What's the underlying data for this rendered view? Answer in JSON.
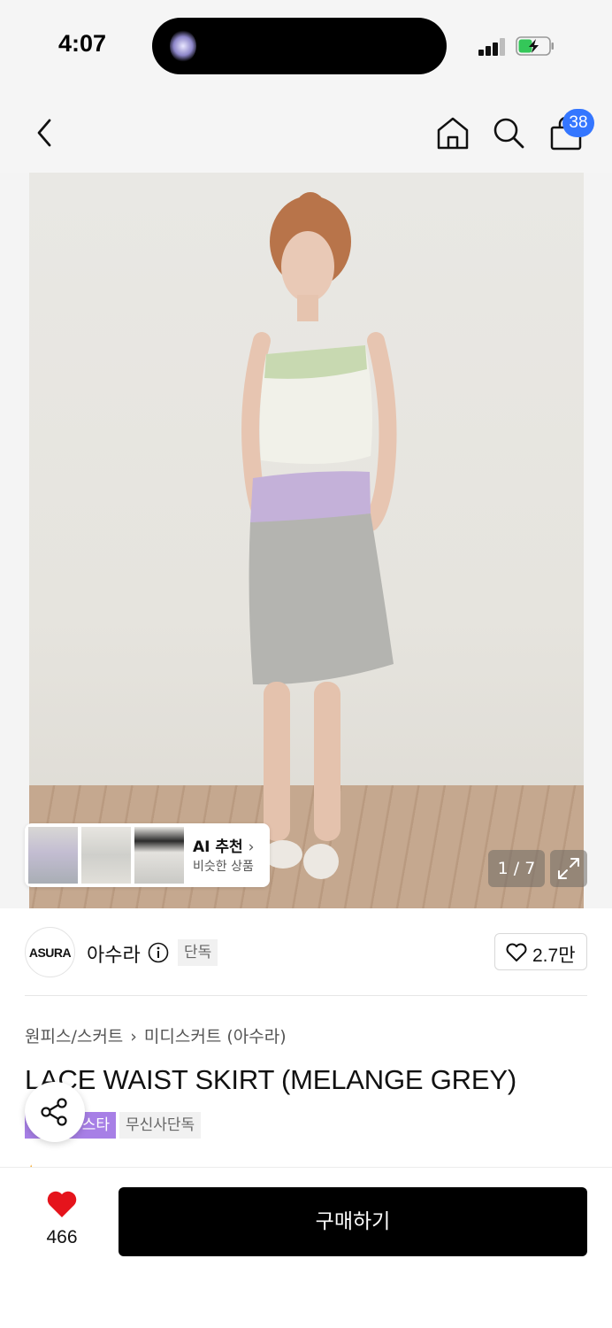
{
  "status_bar": {
    "time": "4:07"
  },
  "header": {
    "back_icon": "chevron-left-icon",
    "home_icon": "home-icon",
    "search_icon": "search-icon",
    "cart_icon": "shopping-bag-icon",
    "cart_count": "38",
    "badge_color": "#3476ff"
  },
  "gallery": {
    "ai_recommend": {
      "title": "AI 추천",
      "subtitle": "비슷한 상품"
    },
    "counter": "1 / 7",
    "expand_icon": "expand-icon"
  },
  "brand": {
    "logo_text": "ASURA",
    "name": "아수라",
    "exclusive_tag": "단독",
    "like_count": "2.7만"
  },
  "product": {
    "breadcrumb": [
      "원피스/스커트",
      "미디스커트 (아수라)"
    ],
    "title": "LACE WAIST SKIRT (MELANGE GREY)",
    "tags": [
      {
        "label": "스타",
        "color": "#a77fe6"
      },
      {
        "label": "무신사단독"
      }
    ],
    "share_icon": "share-icon"
  },
  "bottom_bar": {
    "heart_count": "466",
    "heart_color": "#e5141c",
    "buy_label": "구매하기"
  }
}
